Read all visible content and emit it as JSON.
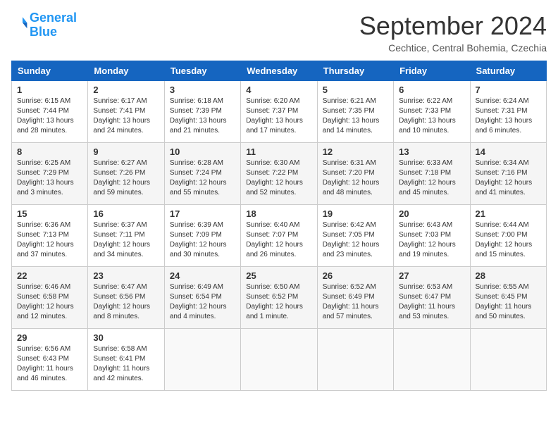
{
  "logo": {
    "line1": "General",
    "line2": "Blue"
  },
  "title": "September 2024",
  "subtitle": "Cechtice, Central Bohemia, Czechia",
  "days_header": [
    "Sunday",
    "Monday",
    "Tuesday",
    "Wednesday",
    "Thursday",
    "Friday",
    "Saturday"
  ],
  "weeks": [
    [
      {
        "day": "1",
        "info": "Sunrise: 6:15 AM\nSunset: 7:44 PM\nDaylight: 13 hours\nand 28 minutes."
      },
      {
        "day": "2",
        "info": "Sunrise: 6:17 AM\nSunset: 7:41 PM\nDaylight: 13 hours\nand 24 minutes."
      },
      {
        "day": "3",
        "info": "Sunrise: 6:18 AM\nSunset: 7:39 PM\nDaylight: 13 hours\nand 21 minutes."
      },
      {
        "day": "4",
        "info": "Sunrise: 6:20 AM\nSunset: 7:37 PM\nDaylight: 13 hours\nand 17 minutes."
      },
      {
        "day": "5",
        "info": "Sunrise: 6:21 AM\nSunset: 7:35 PM\nDaylight: 13 hours\nand 14 minutes."
      },
      {
        "day": "6",
        "info": "Sunrise: 6:22 AM\nSunset: 7:33 PM\nDaylight: 13 hours\nand 10 minutes."
      },
      {
        "day": "7",
        "info": "Sunrise: 6:24 AM\nSunset: 7:31 PM\nDaylight: 13 hours\nand 6 minutes."
      }
    ],
    [
      {
        "day": "8",
        "info": "Sunrise: 6:25 AM\nSunset: 7:29 PM\nDaylight: 13 hours\nand 3 minutes."
      },
      {
        "day": "9",
        "info": "Sunrise: 6:27 AM\nSunset: 7:26 PM\nDaylight: 12 hours\nand 59 minutes."
      },
      {
        "day": "10",
        "info": "Sunrise: 6:28 AM\nSunset: 7:24 PM\nDaylight: 12 hours\nand 55 minutes."
      },
      {
        "day": "11",
        "info": "Sunrise: 6:30 AM\nSunset: 7:22 PM\nDaylight: 12 hours\nand 52 minutes."
      },
      {
        "day": "12",
        "info": "Sunrise: 6:31 AM\nSunset: 7:20 PM\nDaylight: 12 hours\nand 48 minutes."
      },
      {
        "day": "13",
        "info": "Sunrise: 6:33 AM\nSunset: 7:18 PM\nDaylight: 12 hours\nand 45 minutes."
      },
      {
        "day": "14",
        "info": "Sunrise: 6:34 AM\nSunset: 7:16 PM\nDaylight: 12 hours\nand 41 minutes."
      }
    ],
    [
      {
        "day": "15",
        "info": "Sunrise: 6:36 AM\nSunset: 7:13 PM\nDaylight: 12 hours\nand 37 minutes."
      },
      {
        "day": "16",
        "info": "Sunrise: 6:37 AM\nSunset: 7:11 PM\nDaylight: 12 hours\nand 34 minutes."
      },
      {
        "day": "17",
        "info": "Sunrise: 6:39 AM\nSunset: 7:09 PM\nDaylight: 12 hours\nand 30 minutes."
      },
      {
        "day": "18",
        "info": "Sunrise: 6:40 AM\nSunset: 7:07 PM\nDaylight: 12 hours\nand 26 minutes."
      },
      {
        "day": "19",
        "info": "Sunrise: 6:42 AM\nSunset: 7:05 PM\nDaylight: 12 hours\nand 23 minutes."
      },
      {
        "day": "20",
        "info": "Sunrise: 6:43 AM\nSunset: 7:03 PM\nDaylight: 12 hours\nand 19 minutes."
      },
      {
        "day": "21",
        "info": "Sunrise: 6:44 AM\nSunset: 7:00 PM\nDaylight: 12 hours\nand 15 minutes."
      }
    ],
    [
      {
        "day": "22",
        "info": "Sunrise: 6:46 AM\nSunset: 6:58 PM\nDaylight: 12 hours\nand 12 minutes."
      },
      {
        "day": "23",
        "info": "Sunrise: 6:47 AM\nSunset: 6:56 PM\nDaylight: 12 hours\nand 8 minutes."
      },
      {
        "day": "24",
        "info": "Sunrise: 6:49 AM\nSunset: 6:54 PM\nDaylight: 12 hours\nand 4 minutes."
      },
      {
        "day": "25",
        "info": "Sunrise: 6:50 AM\nSunset: 6:52 PM\nDaylight: 12 hours\nand 1 minute."
      },
      {
        "day": "26",
        "info": "Sunrise: 6:52 AM\nSunset: 6:49 PM\nDaylight: 11 hours\nand 57 minutes."
      },
      {
        "day": "27",
        "info": "Sunrise: 6:53 AM\nSunset: 6:47 PM\nDaylight: 11 hours\nand 53 minutes."
      },
      {
        "day": "28",
        "info": "Sunrise: 6:55 AM\nSunset: 6:45 PM\nDaylight: 11 hours\nand 50 minutes."
      }
    ],
    [
      {
        "day": "29",
        "info": "Sunrise: 6:56 AM\nSunset: 6:43 PM\nDaylight: 11 hours\nand 46 minutes."
      },
      {
        "day": "30",
        "info": "Sunrise: 6:58 AM\nSunset: 6:41 PM\nDaylight: 11 hours\nand 42 minutes."
      },
      {
        "day": "",
        "info": ""
      },
      {
        "day": "",
        "info": ""
      },
      {
        "day": "",
        "info": ""
      },
      {
        "day": "",
        "info": ""
      },
      {
        "day": "",
        "info": ""
      }
    ]
  ]
}
